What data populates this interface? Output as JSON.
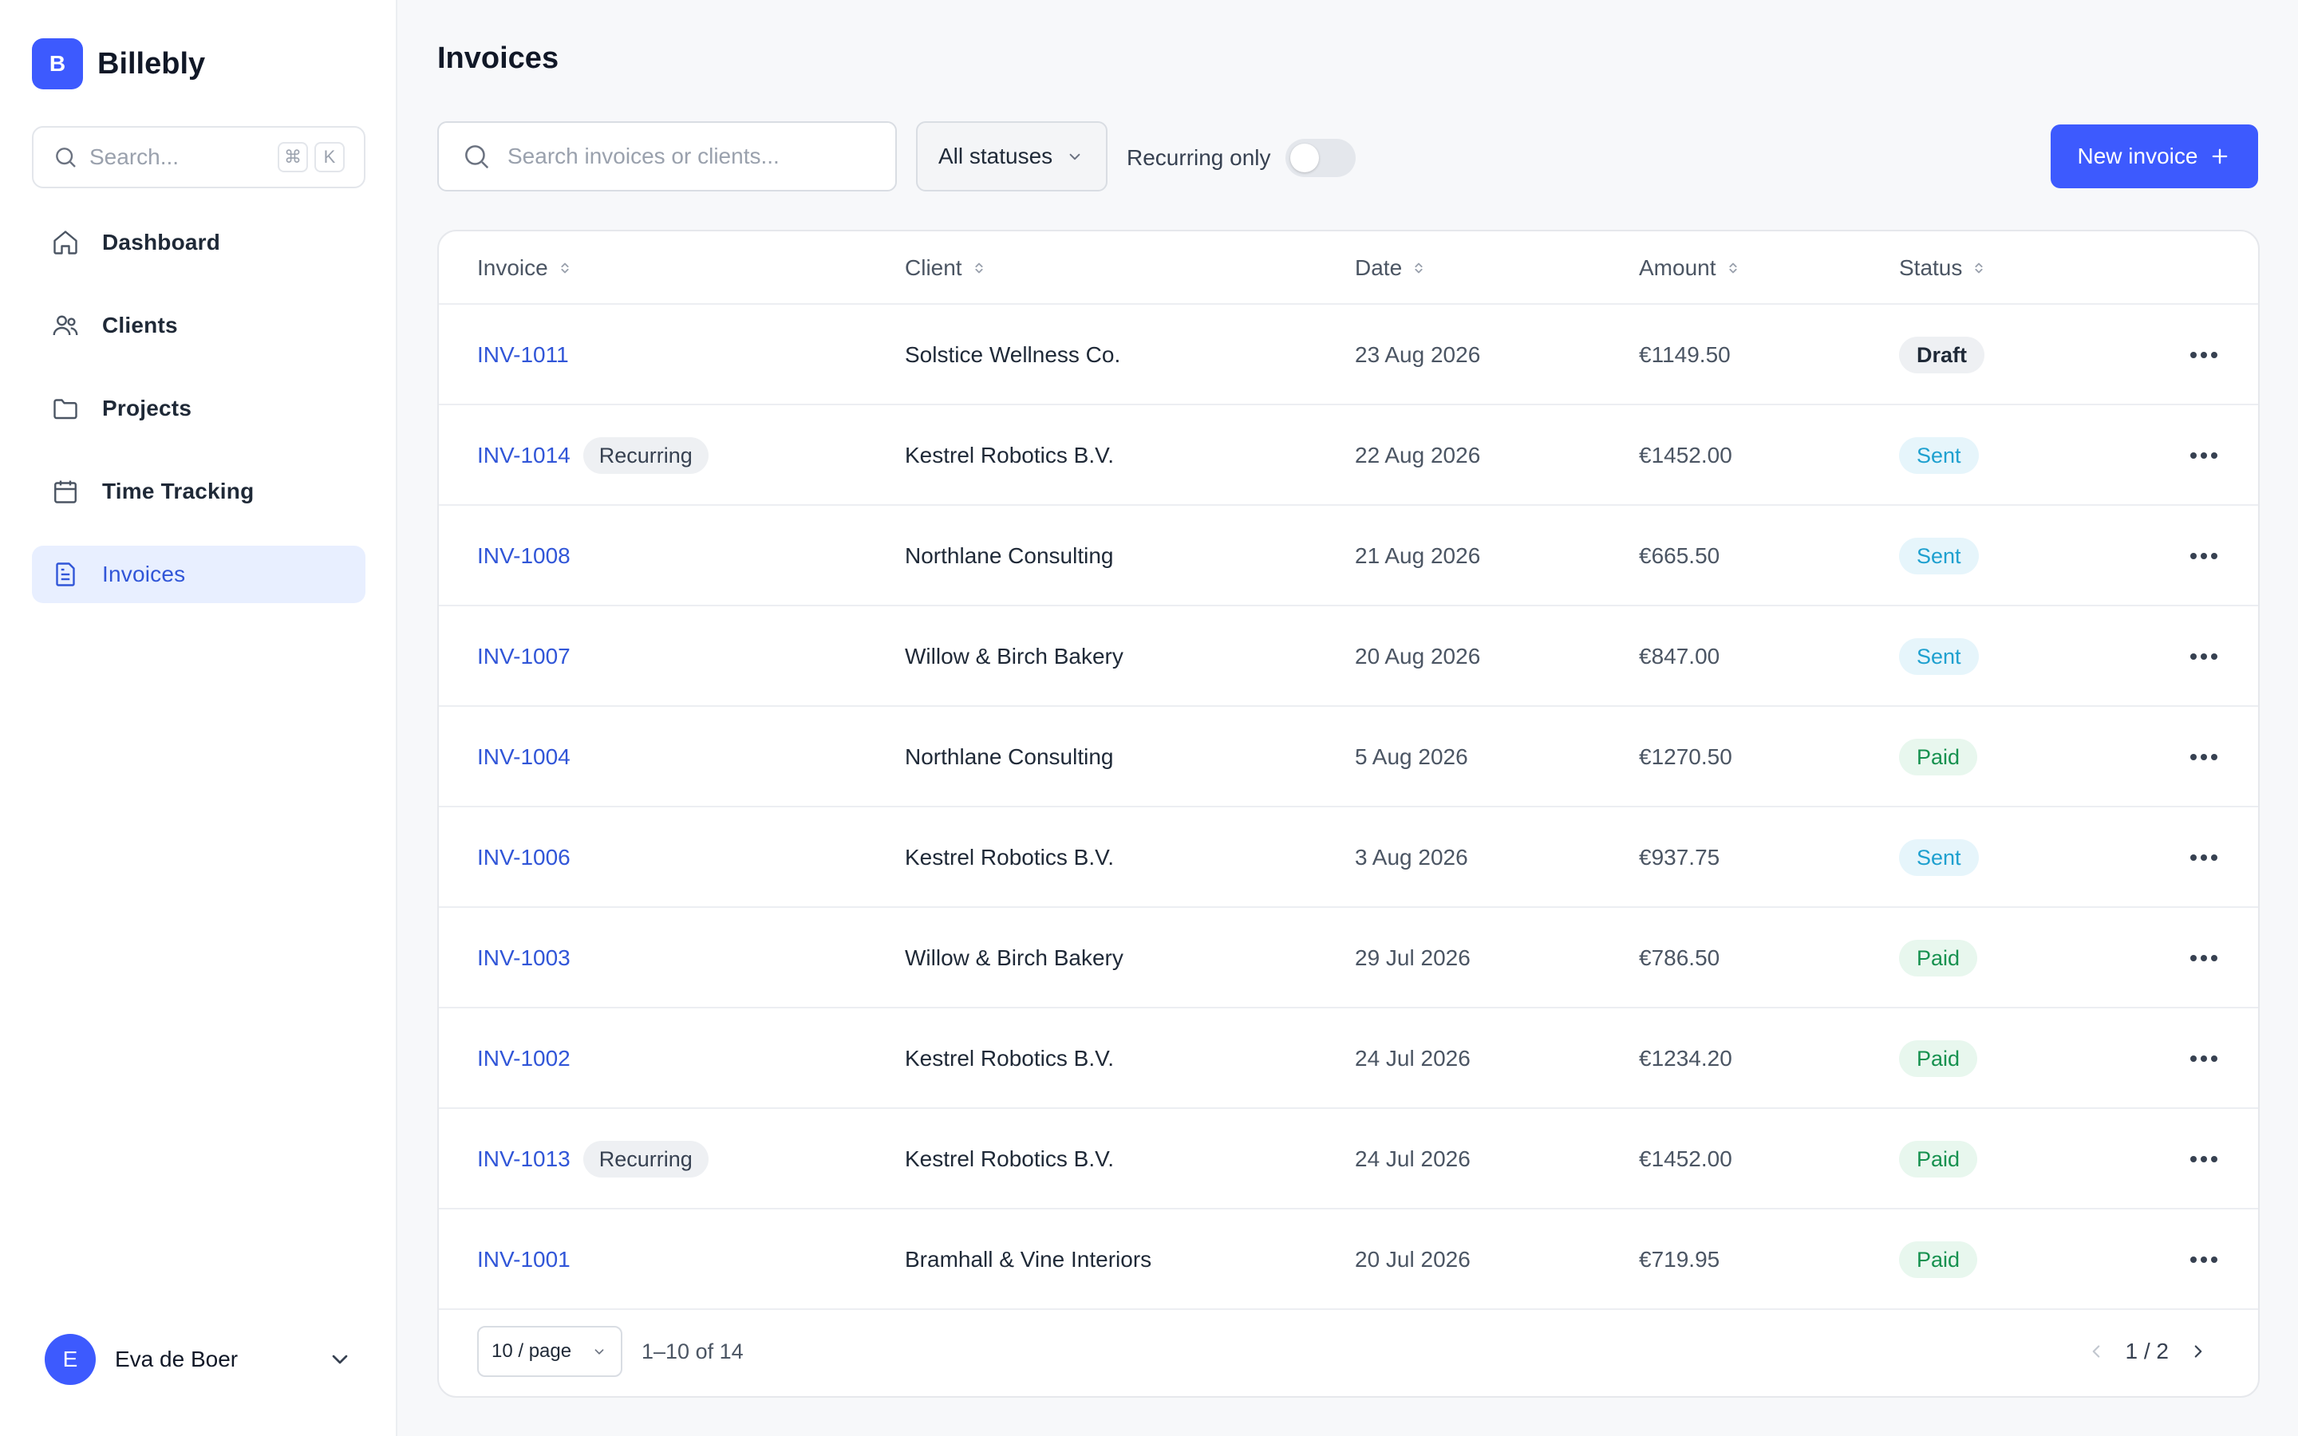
{
  "brand": {
    "logo_letter": "B",
    "name": "Billebly"
  },
  "sidebar": {
    "search_placeholder": "Search...",
    "shortcut_keys": [
      "⌘",
      "K"
    ],
    "items": [
      {
        "label": "Dashboard",
        "icon": "home-icon",
        "active": false
      },
      {
        "label": "Clients",
        "icon": "users-icon",
        "active": false
      },
      {
        "label": "Projects",
        "icon": "folder-icon",
        "active": false
      },
      {
        "label": "Time Tracking",
        "icon": "calendar-icon",
        "active": false
      },
      {
        "label": "Invoices",
        "icon": "invoice-icon",
        "active": true
      }
    ],
    "user": {
      "initial": "E",
      "name": "Eva de Boer"
    }
  },
  "main": {
    "title": "Invoices",
    "search_placeholder": "Search invoices or clients...",
    "status_filter": "All statuses",
    "recurring_label": "Recurring only",
    "recurring_on": false,
    "new_button": "New invoice"
  },
  "table": {
    "columns": [
      "Invoice",
      "Client",
      "Date",
      "Amount",
      "Status"
    ],
    "rows": [
      {
        "invoice": "INV-1011",
        "recurring": "",
        "client": "Solstice Wellness Co.",
        "date": "23 Aug 2026",
        "amount": "€1149.50",
        "status": "Draft"
      },
      {
        "invoice": "INV-1014",
        "recurring": "Recurring",
        "client": "Kestrel Robotics B.V.",
        "date": "22 Aug 2026",
        "amount": "€1452.00",
        "status": "Sent"
      },
      {
        "invoice": "INV-1008",
        "recurring": "",
        "client": "Northlane Consulting",
        "date": "21 Aug 2026",
        "amount": "€665.50",
        "status": "Sent"
      },
      {
        "invoice": "INV-1007",
        "recurring": "",
        "client": "Willow & Birch Bakery",
        "date": "20 Aug 2026",
        "amount": "€847.00",
        "status": "Sent"
      },
      {
        "invoice": "INV-1004",
        "recurring": "",
        "client": "Northlane Consulting",
        "date": "5 Aug 2026",
        "amount": "€1270.50",
        "status": "Paid"
      },
      {
        "invoice": "INV-1006",
        "recurring": "",
        "client": "Kestrel Robotics B.V.",
        "date": "3 Aug 2026",
        "amount": "€937.75",
        "status": "Sent"
      },
      {
        "invoice": "INV-1003",
        "recurring": "",
        "client": "Willow & Birch Bakery",
        "date": "29 Jul 2026",
        "amount": "€786.50",
        "status": "Paid"
      },
      {
        "invoice": "INV-1002",
        "recurring": "",
        "client": "Kestrel Robotics B.V.",
        "date": "24 Jul 2026",
        "amount": "€1234.20",
        "status": "Paid"
      },
      {
        "invoice": "INV-1013",
        "recurring": "Recurring",
        "client": "Kestrel Robotics B.V.",
        "date": "24 Jul 2026",
        "amount": "€1452.00",
        "status": "Paid"
      },
      {
        "invoice": "INV-1001",
        "recurring": "",
        "client": "Bramhall & Vine Interiors",
        "date": "20 Jul 2026",
        "amount": "€719.95",
        "status": "Paid"
      }
    ],
    "footer": {
      "page_size": "10 / page",
      "range": "1–10 of 14",
      "page": "1 / 2"
    }
  },
  "colors": {
    "accent": "#3d5afe",
    "link": "#3156d8",
    "sent": "#1ea0cf",
    "paid": "#16914f"
  }
}
